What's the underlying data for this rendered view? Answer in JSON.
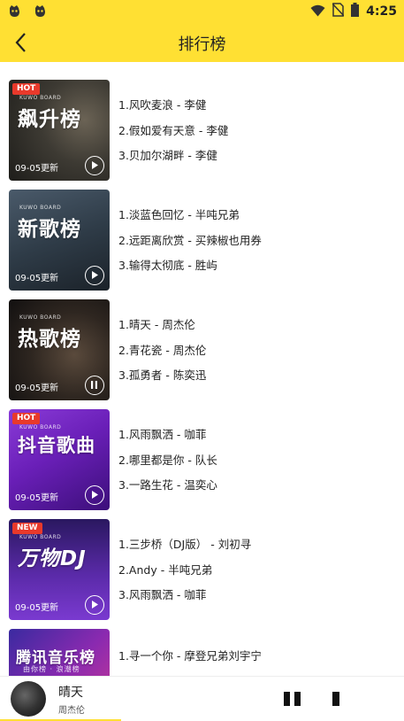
{
  "status_bar": {
    "time": "4:25",
    "icons": [
      "app-notification-icon",
      "app-notification-icon",
      "wifi-icon",
      "no-sim-icon",
      "battery-icon"
    ]
  },
  "header": {
    "title": "排行榜",
    "back_icon": "chevron-left-icon"
  },
  "colors": {
    "accent": "#FFE033",
    "hot_badge": "#E8392B",
    "new_badge": "#E8392B"
  },
  "rankings": [
    {
      "name": "飙升榜",
      "board_tag": "KUWO BOARD",
      "badge": "HOT",
      "date": "09-05更新",
      "state": "play",
      "songs": [
        "1.风吹麦浪 - 李健",
        "2.假如爱有天意 - 李健",
        "3.贝加尔湖畔 - 李健"
      ]
    },
    {
      "name": "新歌榜",
      "board_tag": "KUWO BOARD",
      "badge": "",
      "date": "09-05更新",
      "state": "play",
      "songs": [
        "1.淡蓝色回忆 - 半吨兄弟",
        "2.远距离欣赏 - 买辣椒也用券",
        "3.输得太彻底 - 胜屿"
      ]
    },
    {
      "name": "热歌榜",
      "board_tag": "KUWO BOARD",
      "badge": "",
      "date": "09-05更新",
      "state": "pause",
      "songs": [
        "1.晴天 - 周杰伦",
        "2.青花瓷 - 周杰伦",
        "3.孤勇者 - 陈奕迅"
      ]
    },
    {
      "name": "抖音歌曲",
      "board_tag": "KUWO BOARD",
      "badge": "HOT",
      "date": "09-05更新",
      "state": "play",
      "songs": [
        "1.风雨飘洒 - 咖菲",
        "2.哪里都是你 - 队长",
        "3.一路生花 - 温奕心"
      ]
    },
    {
      "name": "万物DJ",
      "board_tag": "KUWO BOARD",
      "badge": "NEW",
      "date": "09-05更新",
      "state": "play",
      "songs": [
        "1.三步桥（DJ版） - 刘初寻",
        "2.Andy - 半吨兄弟",
        "3.风雨飘洒 - 咖菲"
      ]
    },
    {
      "name": "腾讯音乐榜",
      "board_tag": "",
      "badge": "",
      "subtitle": "由你榜 · 浪潮榜",
      "date": "",
      "state": "",
      "songs": [
        "1.寻一个你 - 摩登兄弟刘宇宁",
        "",
        ""
      ]
    }
  ],
  "player": {
    "title": "晴天",
    "artist": "周杰伦",
    "progress": 0.3
  }
}
